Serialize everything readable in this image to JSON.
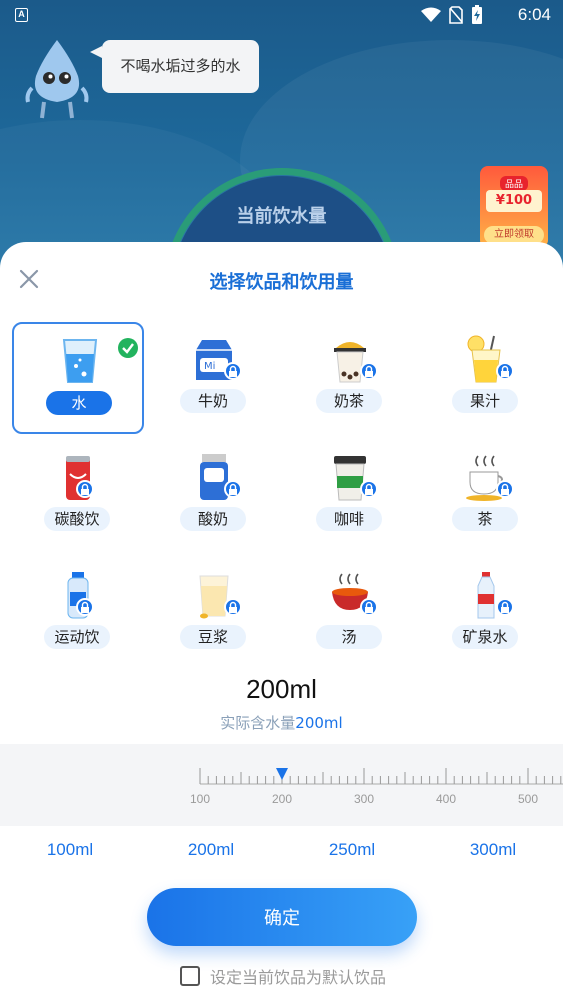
{
  "status_bar": {
    "time": "6:04",
    "notification_badge": "A"
  },
  "background": {
    "bubble_text": "不喝水垢过多的水",
    "gauge_label": "当前饮水量",
    "promo": {
      "tag": "品品",
      "amount": "¥100",
      "cta": "立即领取"
    }
  },
  "sheet": {
    "title": "选择饮品和饮用量",
    "close_icon": "close-icon",
    "drinks": [
      {
        "label": "水",
        "icon": "water-glass-icon",
        "selected": true,
        "locked": false
      },
      {
        "label": "牛奶",
        "icon": "milk-carton-icon",
        "selected": false,
        "locked": true
      },
      {
        "label": "奶茶",
        "icon": "milk-tea-icon",
        "selected": false,
        "locked": true
      },
      {
        "label": "果汁",
        "icon": "juice-icon",
        "selected": false,
        "locked": true
      },
      {
        "label": "碳酸饮",
        "icon": "soda-can-icon",
        "selected": false,
        "locked": true
      },
      {
        "label": "酸奶",
        "icon": "yogurt-icon",
        "selected": false,
        "locked": true
      },
      {
        "label": "咖啡",
        "icon": "coffee-cup-icon",
        "selected": false,
        "locked": true
      },
      {
        "label": "茶",
        "icon": "tea-cup-icon",
        "selected": false,
        "locked": true
      },
      {
        "label": "运动饮",
        "icon": "sports-drink-icon",
        "selected": false,
        "locked": true
      },
      {
        "label": "豆浆",
        "icon": "soy-milk-icon",
        "selected": false,
        "locked": true
      },
      {
        "label": "汤",
        "icon": "soup-bowl-icon",
        "selected": false,
        "locked": true
      },
      {
        "label": "矿泉水",
        "icon": "mineral-water-icon",
        "selected": false,
        "locked": true
      }
    ],
    "amount": "200ml",
    "actual_prefix": "实际含水量",
    "actual_value": "200ml",
    "ruler": {
      "labels": [
        "100",
        "200",
        "300",
        "400",
        "500"
      ],
      "current": 200
    },
    "presets": [
      "100ml",
      "200ml",
      "250ml",
      "300ml"
    ],
    "confirm_label": "确定",
    "default_label": "设定当前饮品为默认饮品",
    "default_checked": false
  },
  "colors": {
    "accent": "#1a73e8",
    "title": "#1a6fd6",
    "check": "#22b35e"
  }
}
